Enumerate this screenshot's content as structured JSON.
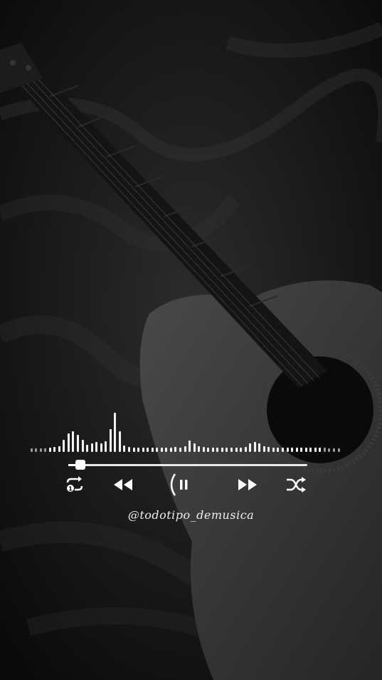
{
  "player": {
    "handle": "@todotipo_demusica",
    "progress_fraction": 0.03,
    "visualizer_levels": [
      0.08,
      0.08,
      0.08,
      0.08,
      0.1,
      0.12,
      0.14,
      0.3,
      0.45,
      0.5,
      0.42,
      0.3,
      0.18,
      0.2,
      0.25,
      0.2,
      0.26,
      0.55,
      0.95,
      0.5,
      0.16,
      0.12,
      0.1,
      0.1,
      0.1,
      0.1,
      0.1,
      0.1,
      0.1,
      0.1,
      0.1,
      0.12,
      0.1,
      0.14,
      0.28,
      0.2,
      0.14,
      0.12,
      0.1,
      0.1,
      0.1,
      0.1,
      0.1,
      0.1,
      0.1,
      0.1,
      0.12,
      0.2,
      0.24,
      0.2,
      0.14,
      0.12,
      0.1,
      0.1,
      0.1,
      0.1,
      0.1,
      0.1,
      0.1,
      0.1,
      0.1,
      0.1,
      0.1,
      0.1,
      0.08,
      0.08,
      0.08
    ]
  },
  "controls": {
    "repeat": {
      "icon": "repeat-one-icon"
    },
    "previous": {
      "icon": "rewind-icon"
    },
    "play_pause": {
      "icon": "pause-icon"
    },
    "next": {
      "icon": "fast-forward-icon"
    },
    "shuffle": {
      "icon": "shuffle-icon"
    }
  },
  "colors": {
    "foreground": "#ffffff",
    "background": "#0c0c0c"
  }
}
